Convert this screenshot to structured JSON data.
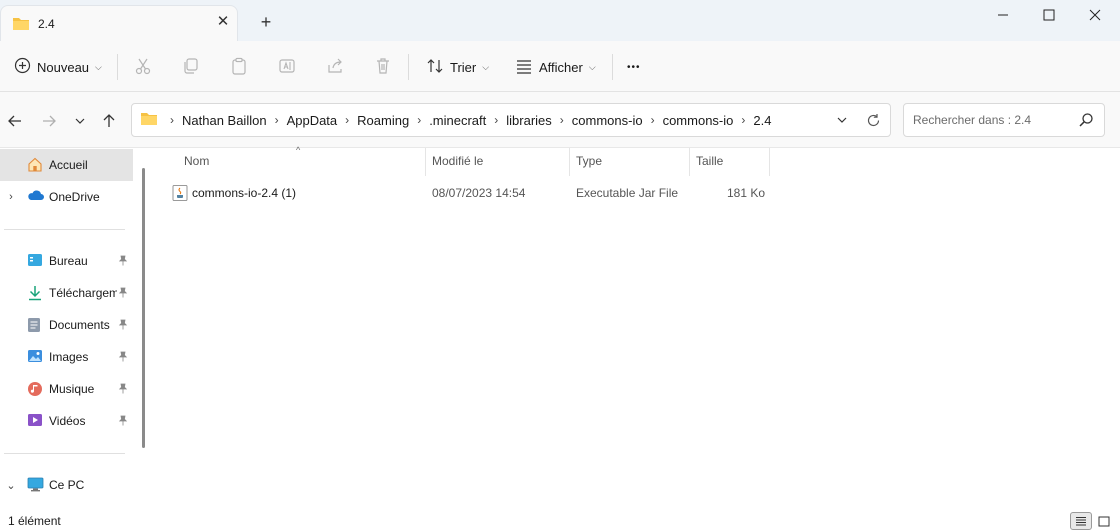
{
  "window": {
    "tab_title": "2.4",
    "tab_close_icon": "close-icon",
    "new_tab_icon": "plus-icon"
  },
  "toolbar": {
    "new_label": "Nouveau",
    "sort_label": "Trier",
    "view_label": "Afficher",
    "more_label": "•••"
  },
  "address": {
    "crumbs": [
      "Nathan Baillon",
      "AppData",
      "Roaming",
      ".minecraft",
      "libraries",
      "commons-io",
      "commons-io",
      "2.4"
    ]
  },
  "search": {
    "placeholder": "Rechercher dans : 2.4"
  },
  "sidebar": {
    "items": [
      {
        "label": "Accueil"
      },
      {
        "label": "OneDrive"
      },
      {
        "label": "Bureau"
      },
      {
        "label": "Téléchargem"
      },
      {
        "label": "Documents"
      },
      {
        "label": "Images"
      },
      {
        "label": "Musique"
      },
      {
        "label": "Vidéos"
      },
      {
        "label": "Ce PC"
      }
    ]
  },
  "table": {
    "columns": [
      "Nom",
      "Modifié le",
      "Type",
      "Taille"
    ],
    "rows": [
      {
        "name": "commons-io-2.4 (1)",
        "modified": "08/07/2023 14:54",
        "type": "Executable Jar File",
        "size": "181 Ko"
      }
    ]
  },
  "status": {
    "count": "1 élément"
  },
  "colors": {
    "chrome": "#eef3f8",
    "pane": "#ffffff",
    "selected": "#e4e4e4",
    "folder": "#f6c244"
  }
}
